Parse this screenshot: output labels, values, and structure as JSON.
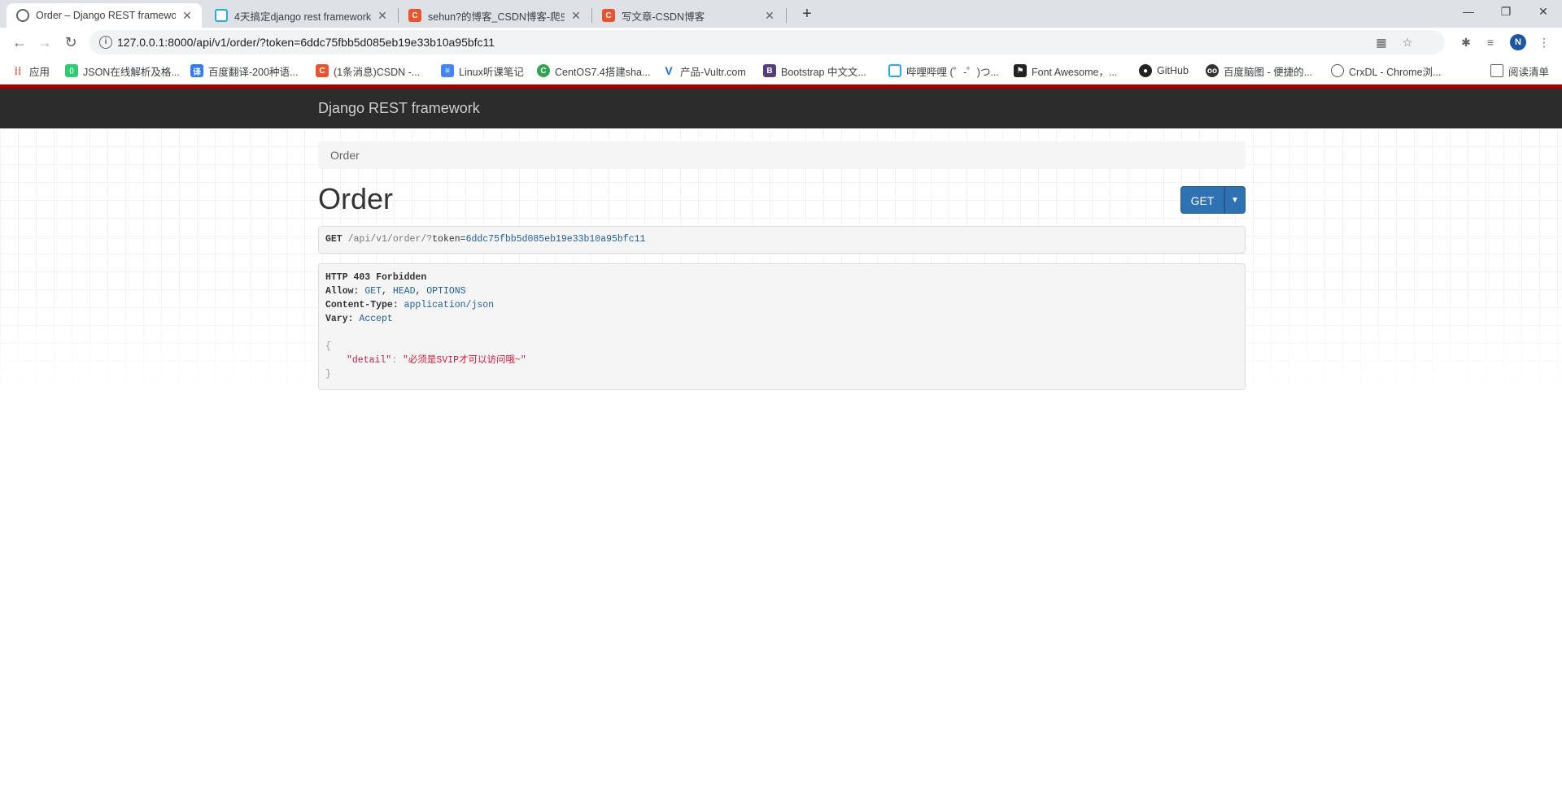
{
  "browser": {
    "tabs": [
      {
        "title": "Order – Django REST framewo",
        "icon": "globe-icon",
        "active": true
      },
      {
        "title": "4天搞定django rest framework",
        "icon": "bilibili-icon",
        "active": false
      },
      {
        "title": "sehun?的博客_CSDN博客-爬虫",
        "icon": "csdn-icon",
        "active": false
      },
      {
        "title": "写文章-CSDN博客",
        "icon": "csdn-icon",
        "active": false
      }
    ],
    "new_tab_glyph": "+",
    "url": "127.0.0.1:8000/api/v1/order/?token=6ddc75fbb5d085eb19e33b10a95bfc11",
    "profile_initial": "N",
    "bookmarks": [
      {
        "label": "应用",
        "icon": "apps-grid-icon",
        "color": "#4285f4"
      },
      {
        "label": "JSON在线解析及格...",
        "icon": "json-icon",
        "color": "#2ecc71"
      },
      {
        "label": "百度翻译-200种语...",
        "icon": "baidu-translate-icon",
        "color": "#2f7cf6"
      },
      {
        "label": "(1条消息)CSDN -...",
        "icon": "csdn-icon",
        "color": "#e9532d"
      },
      {
        "label": "Linux听课笔记",
        "icon": "docs-icon",
        "color": "#4285f4"
      },
      {
        "label": "CentOS7.4搭建sha...",
        "icon": "centos-icon",
        "color": "#2ea44f"
      },
      {
        "label": "产品-Vultr.com",
        "icon": "vultr-icon",
        "color": "#1e6fd9"
      },
      {
        "label": "Bootstrap 中文文...",
        "icon": "bootstrap-icon",
        "color": "#563d7c"
      },
      {
        "label": "哔哩哔哩 (゜-゜)つ...",
        "icon": "bilibili-icon",
        "color": "#23ade5"
      },
      {
        "label": "Font Awesome，...",
        "icon": "font-awesome-icon",
        "color": "#222222"
      },
      {
        "label": "GitHub",
        "icon": "github-icon",
        "color": "#222222"
      },
      {
        "label": "百度脑图 - 便捷的...",
        "icon": "baidu-naotu-icon",
        "color": "#333333"
      },
      {
        "label": "CrxDL - Chrome浏...",
        "icon": "crxdl-icon",
        "color": "#555555"
      }
    ],
    "reading_list_label": "阅读清单"
  },
  "drf": {
    "brand": "Django REST framework",
    "breadcrumb": "Order",
    "title": "Order",
    "get_button": "GET",
    "request": {
      "method": "GET",
      "path": "/api/v1/order/",
      "query_sep": "?",
      "query_key": "token=",
      "query_value": "6ddc75fbb5d085eb19e33b10a95bfc11"
    },
    "response": {
      "status": "HTTP 403 Forbidden",
      "allow_label": "Allow:",
      "allow_values": [
        "GET",
        "HEAD",
        "OPTIONS"
      ],
      "content_type_label": "Content-Type:",
      "content_type_value": "application/json",
      "vary_label": "Vary:",
      "vary_value": "Accept",
      "open_brace": "{",
      "detail_key": "\"detail\"",
      "colon": ": ",
      "detail_value": "\"必须是SVIP才可以访问哦~\"",
      "close_brace": "}"
    }
  },
  "colors": {
    "navbar": "#2c2c2c",
    "navbar_accent": "#a30000",
    "primary_button": "#2f72b4"
  }
}
